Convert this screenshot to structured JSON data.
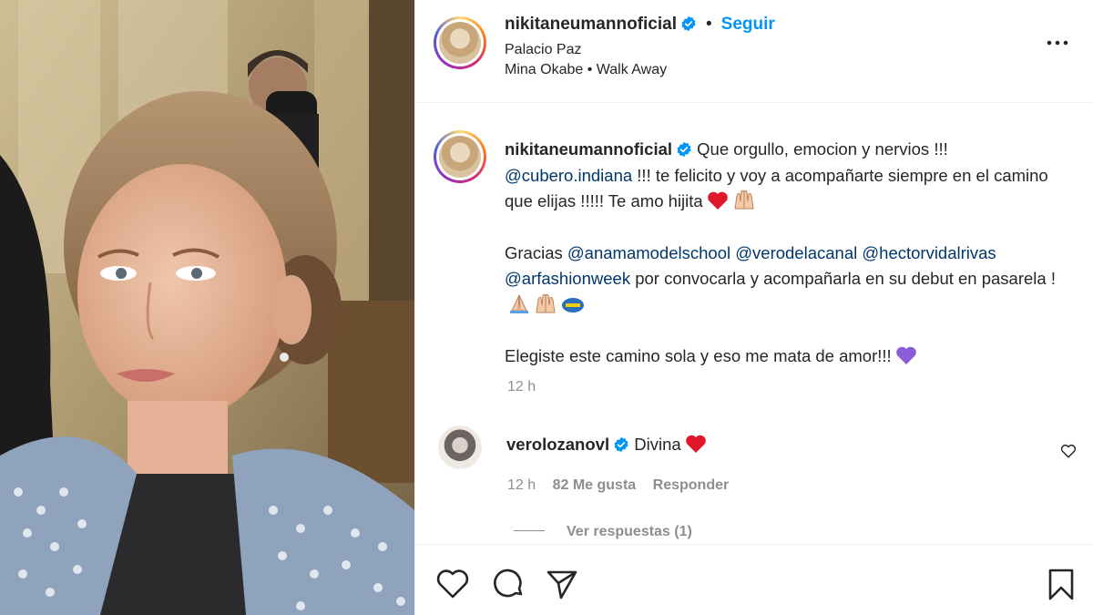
{
  "header": {
    "username": "nikitaneumannoficial",
    "follow_label": "Seguir",
    "location": "Palacio Paz",
    "music": "Mina Okabe • Walk Away"
  },
  "caption": {
    "username": "nikitaneumannoficial",
    "line1_text": "Que orgullo, emocion y nervios !!!",
    "mention1": "@cubero.indiana",
    "line2_text": "!!! te felicito y voy a acompañarte siempre en el camino que elijas !!!!! Te amo hijita",
    "thanks": "Gracias",
    "mentions": [
      "@anamamodelschool",
      "@verodelacanal",
      "@hectorvidalrivas",
      "@arfashionweek"
    ],
    "thanks_rest": "por convocarla y acompañarla en su debut en pasarela !",
    "closing": "Elegiste este camino sola y eso me mata de amor!!!",
    "time": "12 h"
  },
  "comment": {
    "username": "verolozanovl",
    "text": "Divina",
    "time": "12 h",
    "likes": "82 Me gusta",
    "reply_label": "Responder",
    "view_replies": "Ver respuestas (1)"
  },
  "colors": {
    "link": "#0095f6",
    "mention": "#00376b",
    "muted": "#8e8e8e",
    "heart": "#ed4956",
    "purple_heart": "#8b5cd6"
  },
  "icons": [
    "more-icon",
    "verified-icon",
    "heart-icon",
    "comment-icon",
    "share-icon",
    "bookmark-icon"
  ]
}
